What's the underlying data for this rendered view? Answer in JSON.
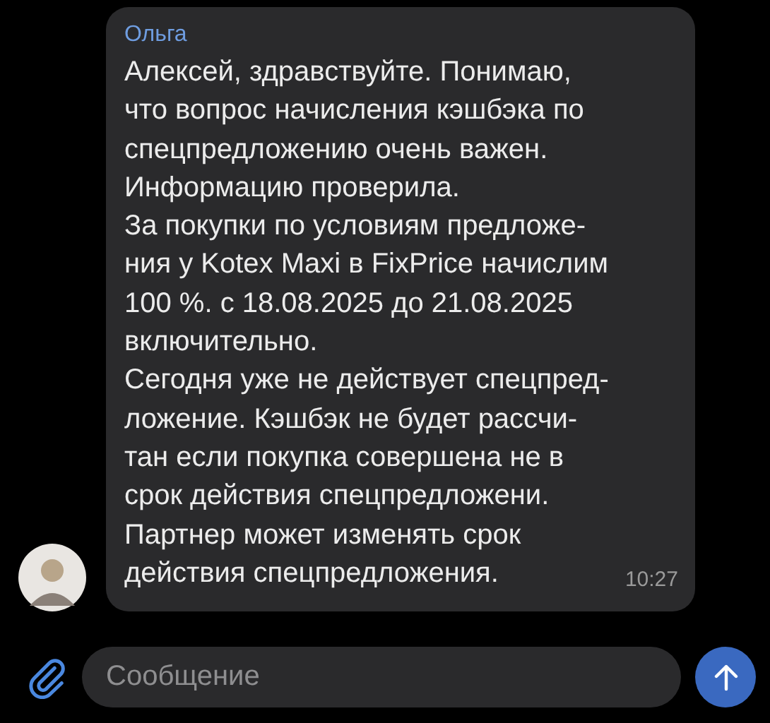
{
  "message": {
    "sender": "Ольга",
    "text": "Алексей, здравствуйте. Понимаю,\nчто вопрос начисления кэшбэка по\nспецпредложению очень важен.\nИнформацию проверила.\nЗа покупки по условиям предложе-\nния у Kotex Maxi в FixPrice начислим\n100 %. с 18.08.2025 до 21.08.2025\nвключительно.\nСегодня уже не действует спецпред-\nложение. Кэшбэк не будет рассчи-\nтан если покупка совершена не в\nсрок действия спецпредложени.\nПартнер может изменять срок\nдействия спецпредложения.",
    "time": "10:27"
  },
  "composer": {
    "placeholder": "Сообщение"
  }
}
